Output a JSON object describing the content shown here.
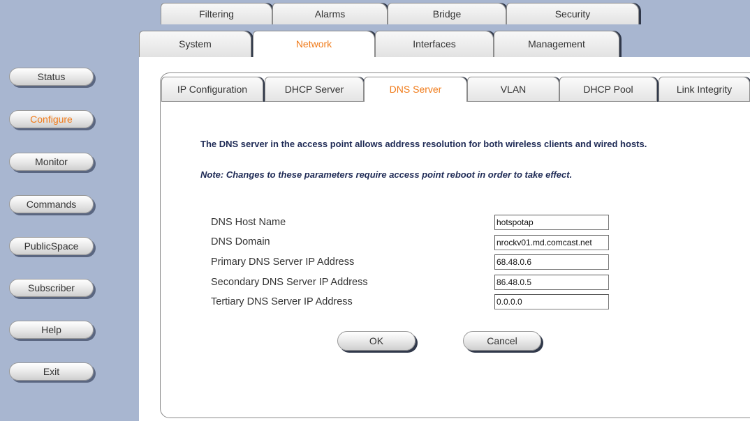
{
  "sidebar": {
    "items": [
      {
        "label": "Status",
        "active": false
      },
      {
        "label": "Configure",
        "active": true
      },
      {
        "label": "Monitor",
        "active": false
      },
      {
        "label": "Commands",
        "active": false
      },
      {
        "label": "PublicSpace",
        "active": false
      },
      {
        "label": "Subscriber",
        "active": false
      },
      {
        "label": "Help",
        "active": false
      },
      {
        "label": "Exit",
        "active": false
      }
    ]
  },
  "top_tabs": {
    "row1": [
      "Filtering",
      "Alarms",
      "Bridge",
      "Security"
    ],
    "row2": [
      "System",
      "Network",
      "Interfaces",
      "Management"
    ],
    "selected": "Network"
  },
  "sub_tabs": {
    "items": [
      "IP Configuration",
      "DHCP Server",
      "DNS Server",
      "VLAN",
      "DHCP Pool",
      "Link Integrity"
    ],
    "selected": "DNS Server"
  },
  "main": {
    "intro": "The DNS server in the access point allows address resolution for both wireless clients and wired hosts.",
    "note": "Note: Changes to these parameters require access point reboot in order to take effect.",
    "fields": [
      {
        "label": "DNS Host Name",
        "value": "hotspotap"
      },
      {
        "label": "DNS Domain",
        "value": "nrockv01.md.comcast.net"
      },
      {
        "label": "Primary DNS Server IP Address",
        "value": "68.48.0.6"
      },
      {
        "label": "Secondary DNS Server IP Address",
        "value": "86.48.0.5"
      },
      {
        "label": "Tertiary DNS Server IP Address",
        "value": "0.0.0.0"
      }
    ],
    "ok_label": "OK",
    "cancel_label": "Cancel"
  },
  "colors": {
    "accent": "#f07a18",
    "sidebar_bg": "#a8b6d0",
    "heading_text": "#1e2a55"
  }
}
